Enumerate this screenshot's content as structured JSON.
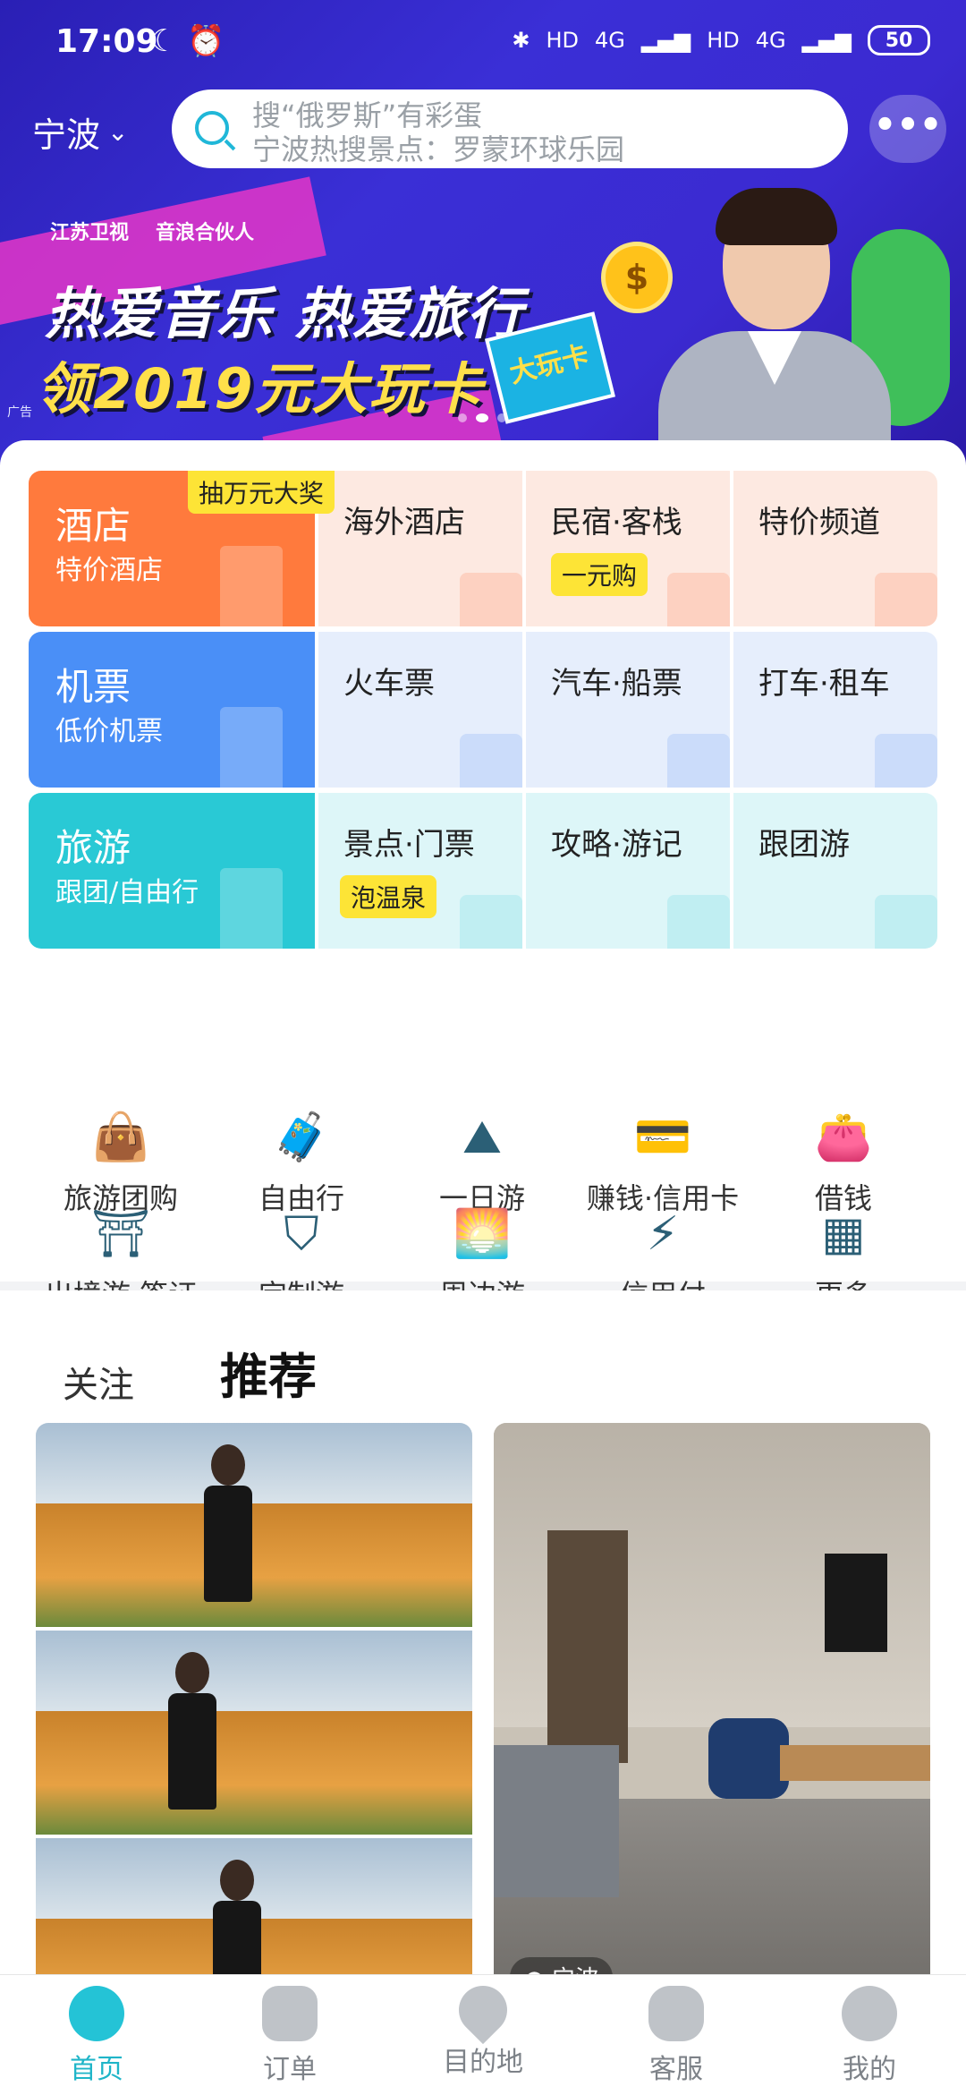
{
  "status_bar": {
    "time": "17:09",
    "hd1": "HD",
    "net1": "4G",
    "hd2": "HD",
    "net2": "4G",
    "battery": "50"
  },
  "header": {
    "city": "宁波",
    "search_line1": "搜“俄罗斯”有彩蛋",
    "search_line2": "宁波热搜景点：罗蒙环球乐园",
    "more": "•••"
  },
  "banner": {
    "logo1": "江苏卫视",
    "logo2": "音浪合伙人",
    "headline": "热爱音乐 热爱旅行",
    "subline": "领2019元大玩卡",
    "ticket_text": "大玩卡",
    "ad_tag": "广告",
    "coin": "$"
  },
  "categories": {
    "hotel": {
      "title": "酒店",
      "subtitle": "特价酒店",
      "promo_badge": "抽万元大奖",
      "items": [
        "海外酒店",
        "民宿·客栈",
        "特价频道"
      ],
      "item_badge": "一元购"
    },
    "air": {
      "title": "机票",
      "subtitle": "低价机票",
      "items": [
        "火车票",
        "汽车·船票",
        "打车·租车"
      ]
    },
    "tour": {
      "title": "旅游",
      "subtitle": "跟团/自由行",
      "items": [
        "景点·门票",
        "攻略·游记",
        "跟团游"
      ],
      "item_badge": "泡温泉"
    }
  },
  "quick_icons": {
    "row1": [
      {
        "label": "旅游团购",
        "icon": "shopping-bag-icon"
      },
      {
        "label": "自由行",
        "icon": "suitcase-icon"
      },
      {
        "label": "一日游",
        "icon": "mountain-icon"
      },
      {
        "label": "赚钱·信用卡",
        "icon": "credit-card-icon"
      },
      {
        "label": "借钱",
        "icon": "wallet-icon"
      }
    ],
    "row2": [
      {
        "label": "出境游·签证",
        "icon": "statue-icon"
      },
      {
        "label": "定制游",
        "icon": "custom-tag-icon"
      },
      {
        "label": "周边游",
        "icon": "sunrise-icon"
      },
      {
        "label": "信用付",
        "icon": "flash-ticket-icon"
      },
      {
        "label": "更多",
        "icon": "grid-icon"
      }
    ]
  },
  "feed": {
    "tabs": [
      "关注",
      "推荐"
    ],
    "active_tab": "推荐",
    "right_location": "宁波"
  },
  "bottom_nav": {
    "items": [
      {
        "label": "首页",
        "icon": "home-mascot-icon"
      },
      {
        "label": "订单",
        "icon": "order-icon"
      },
      {
        "label": "目的地",
        "icon": "location-icon"
      },
      {
        "label": "客服",
        "icon": "service-robot-icon"
      },
      {
        "label": "我的",
        "icon": "profile-icon"
      }
    ],
    "active": "首页"
  },
  "colors": {
    "accent": "#24c3d6",
    "hotel": "#ff7a3d",
    "air": "#4a8ff7",
    "tour": "#29c9d5",
    "badge": "#fde436"
  }
}
